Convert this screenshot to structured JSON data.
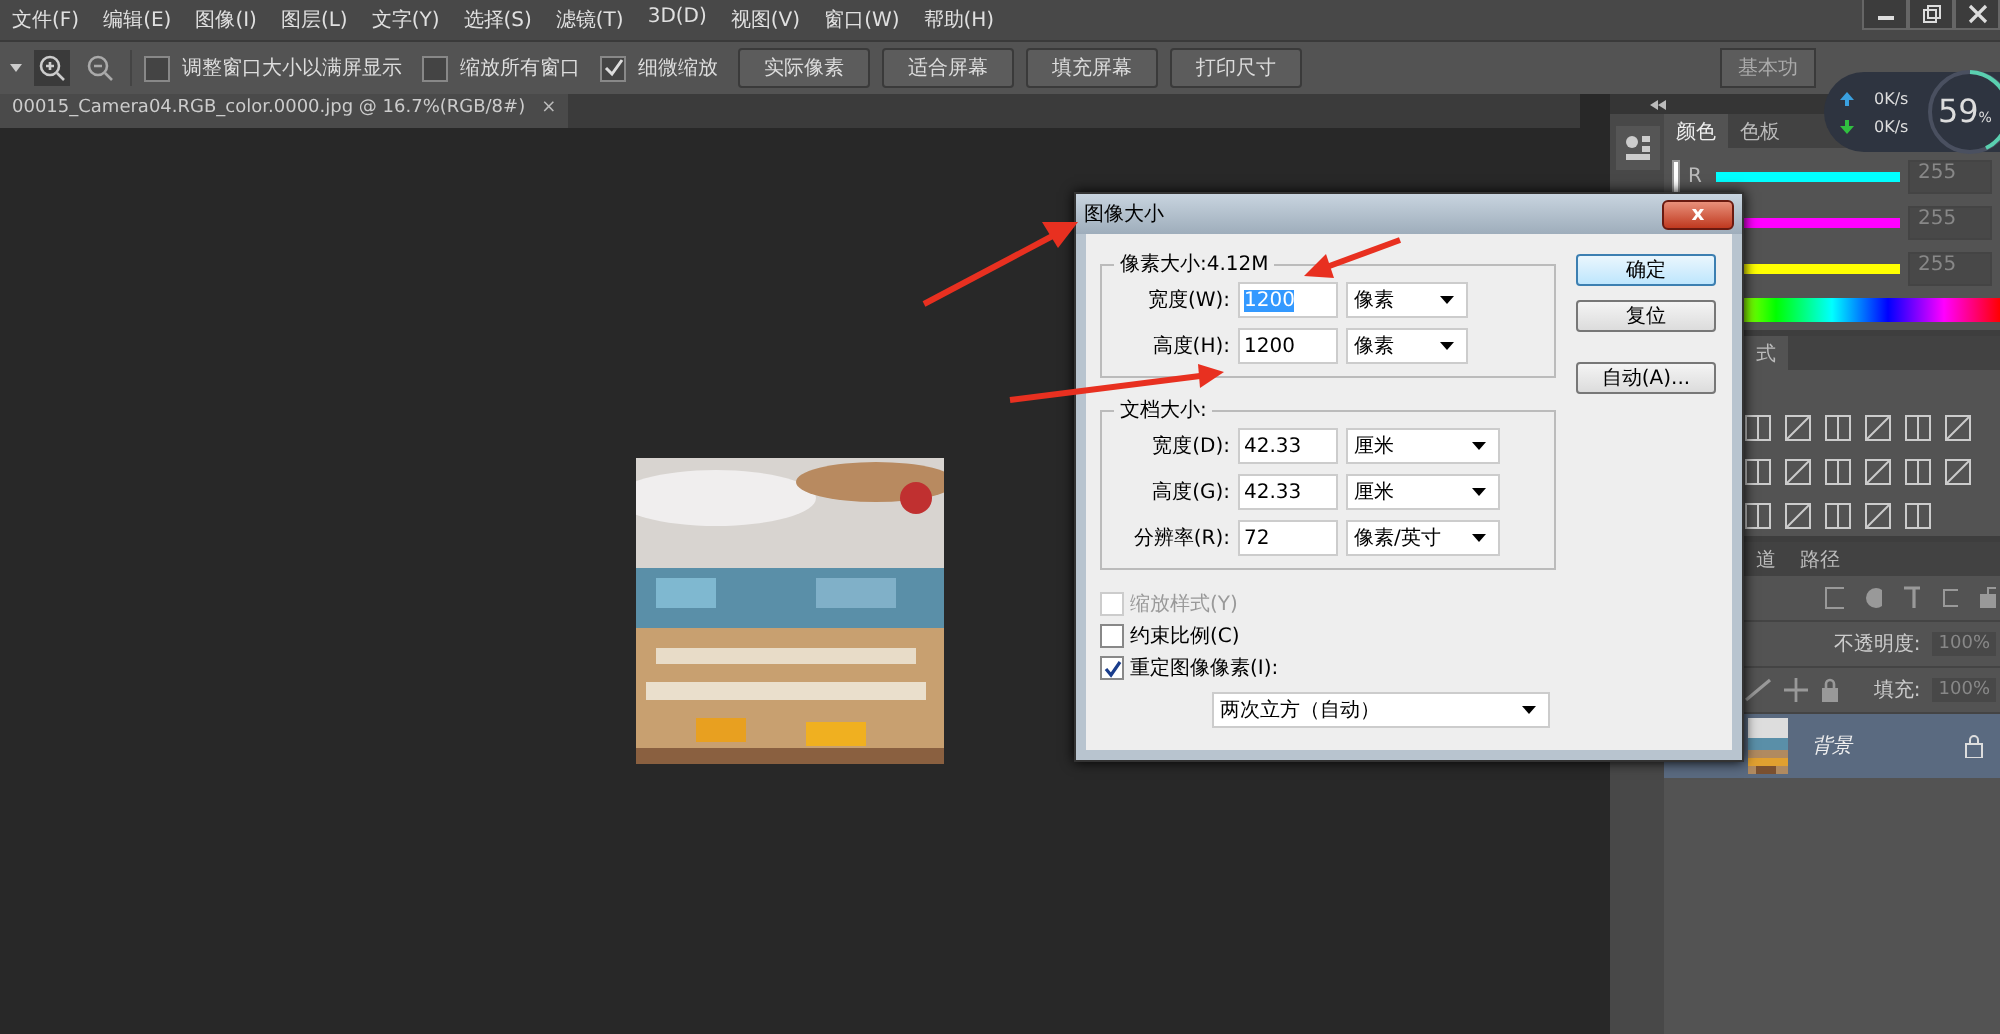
{
  "menu_bar": [
    "文件(F)",
    "编辑(E)",
    "图像(I)",
    "图层(L)",
    "文字(Y)",
    "选择(S)",
    "滤镜(T)",
    "3D(D)",
    "视图(V)",
    "窗口(W)",
    "帮助(H)"
  ],
  "options_bar": {
    "checkboxes": [
      {
        "label": "调整窗口大小以满屏显示",
        "checked": false
      },
      {
        "label": "缩放所有窗口",
        "checked": false
      },
      {
        "label": "细微缩放",
        "checked": true
      }
    ],
    "buttons": [
      "实际像素",
      "适合屏幕",
      "填充屏幕",
      "打印尺寸"
    ],
    "workspace": "基本功"
  },
  "document_tab": {
    "title": "00015_Camera04.RGB_color.0000.jpg @ 16.7%(RGB/8#)",
    "close": "×"
  },
  "network_widget": {
    "upload": "0K/s",
    "download": "0K/s",
    "percent": "59",
    "percent_unit": "%"
  },
  "color_panel": {
    "tabs": [
      {
        "label": "颜色",
        "selected": true
      },
      {
        "label": "色板",
        "selected": false
      }
    ],
    "channel_label": "R",
    "channels": [
      {
        "color": "#00ffff",
        "level": 1,
        "value": "255"
      },
      {
        "color": "#ff00ff",
        "level": 1,
        "value": "255"
      },
      {
        "color": "#ffff00",
        "level": 1,
        "value": "255"
      }
    ]
  },
  "styles_panel": {
    "tab": "式"
  },
  "layers_panel": {
    "tabs": [
      {
        "label": "道",
        "selected": false
      },
      {
        "label": "路径",
        "selected": false
      }
    ],
    "opacity_label": "不透明度:",
    "opacity": "100%",
    "fill_label": "填充:",
    "fill": "100%",
    "layers": [
      {
        "name": "背景",
        "selected": true
      }
    ]
  },
  "dialog": {
    "title": "图像大小",
    "close": "x",
    "pixel_group": {
      "title": "像素大小:4.12M",
      "rows": [
        {
          "label": "宽度(W):",
          "value": "1200",
          "selected": true,
          "unit": "像素"
        },
        {
          "label": "高度(H):",
          "value": "1200",
          "selected": false,
          "unit": "像素"
        }
      ]
    },
    "document_group": {
      "title": "文档大小:",
      "rows": [
        {
          "label": "宽度(D):",
          "value": "42.33",
          "selected": false,
          "unit": "厘米"
        },
        {
          "label": "高度(G):",
          "value": "42.33",
          "selected": false,
          "unit": "厘米"
        },
        {
          "label": "分辨率(R):",
          "value": "72",
          "selected": false,
          "unit": "像素/英寸"
        }
      ]
    },
    "checkboxes": [
      {
        "label": "缩放样式(Y)",
        "checked": false,
        "disabled": true
      },
      {
        "label": "约束比例(C)",
        "checked": false,
        "disabled": false
      },
      {
        "label": "重定图像像素(I):",
        "checked": true,
        "disabled": false
      }
    ],
    "resample": "两次立方（自动）",
    "buttons": [
      {
        "label": "确定",
        "default": true
      },
      {
        "label": "复位",
        "default": false
      },
      {
        "label": "自动(A)...",
        "default": false
      }
    ]
  }
}
